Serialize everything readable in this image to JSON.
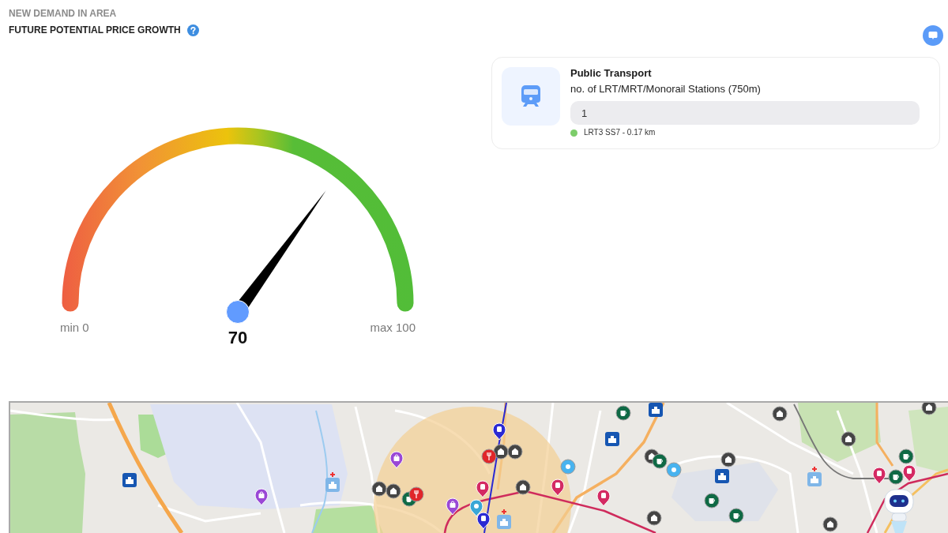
{
  "header": {
    "eyebrow": "NEW DEMAND IN AREA",
    "title": "FUTURE POTENTIAL PRICE GROWTH"
  },
  "gauge": {
    "min_label": "min 0",
    "max_label": "max 100",
    "value": "70",
    "level": 0.7
  },
  "transport_card": {
    "title": "Public Transport",
    "metric": "no. of LRT/MRT/Monorail Stations (750m)",
    "value": "1",
    "stations": [
      {
        "name": "LRT3 SS7 - 0.17 km",
        "color": "#7ccd6a"
      }
    ]
  }
}
